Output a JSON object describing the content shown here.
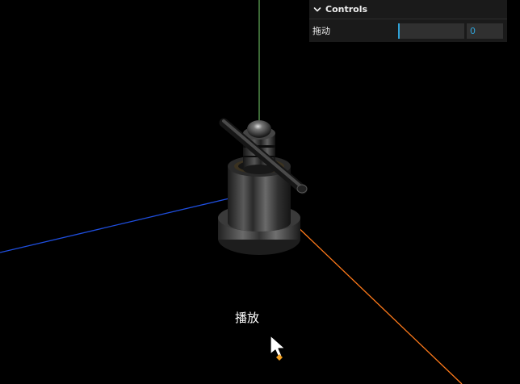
{
  "controls": {
    "title": "Controls",
    "drag_label": "拖动",
    "drag_value": "0",
    "drag_fraction": 0.02
  },
  "play_button": {
    "label": "播放"
  },
  "colors": {
    "y_axis": "#7ad36e",
    "x_axis": "#1f4fe0",
    "z_axis": "#ff7a1a",
    "gui_accent": "#2fa1d6",
    "gui_background": "#1a1a1a",
    "gui_field": "#303030"
  },
  "icons": {
    "header": "chevron-down-icon",
    "cursor": "mouse-pointer-icon"
  }
}
